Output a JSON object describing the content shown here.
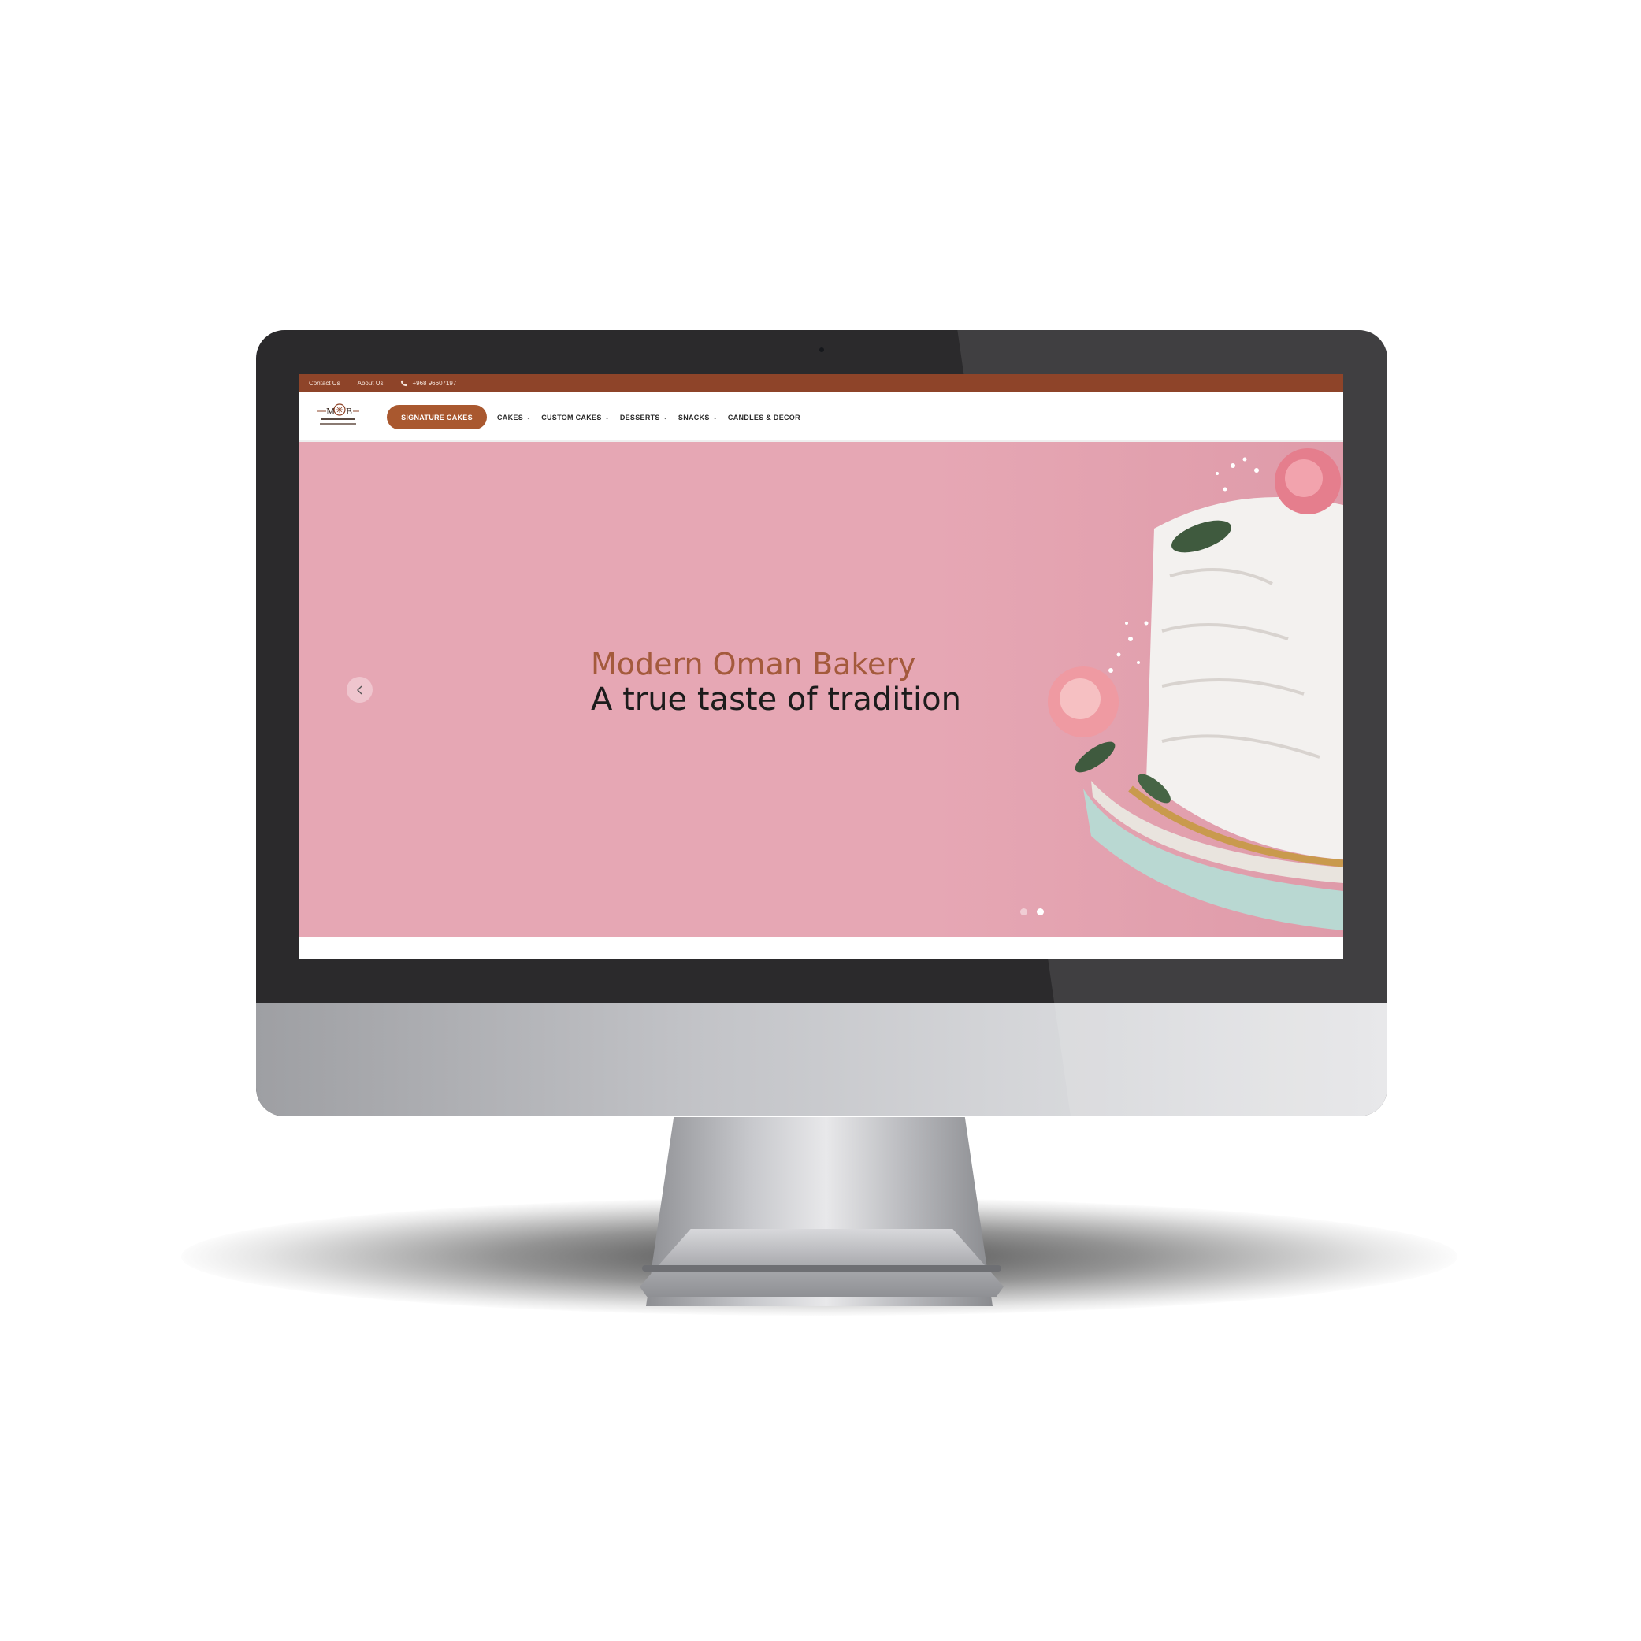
{
  "colors": {
    "topbar": "#8e4429",
    "accent": "#a9582f",
    "hero_bg": "#e6a7b4",
    "hero_title": "#a45a3c",
    "hero_subtitle": "#1c1c1c"
  },
  "topbar": {
    "contact": "Contact Us",
    "about": "About Us",
    "phone": "+968 96607197",
    "phone_icon": "phone-icon"
  },
  "header": {
    "logo_icon": "bakery-logo",
    "signature_button": "SIGNATURE CAKES",
    "menu": [
      {
        "label": "CAKES",
        "has_dropdown": true
      },
      {
        "label": "CUSTOM CAKES",
        "has_dropdown": true
      },
      {
        "label": "DESSERTS",
        "has_dropdown": true
      },
      {
        "label": "SNACKS",
        "has_dropdown": true
      },
      {
        "label": "CANDLES & DECOR",
        "has_dropdown": false
      }
    ]
  },
  "hero": {
    "title": "Modern Oman Bakery",
    "subtitle": "A true taste of tradition",
    "prev_icon": "chevron-left-icon",
    "slides_total": 2,
    "active_slide": 2,
    "image": "white-cake-with-roses"
  }
}
